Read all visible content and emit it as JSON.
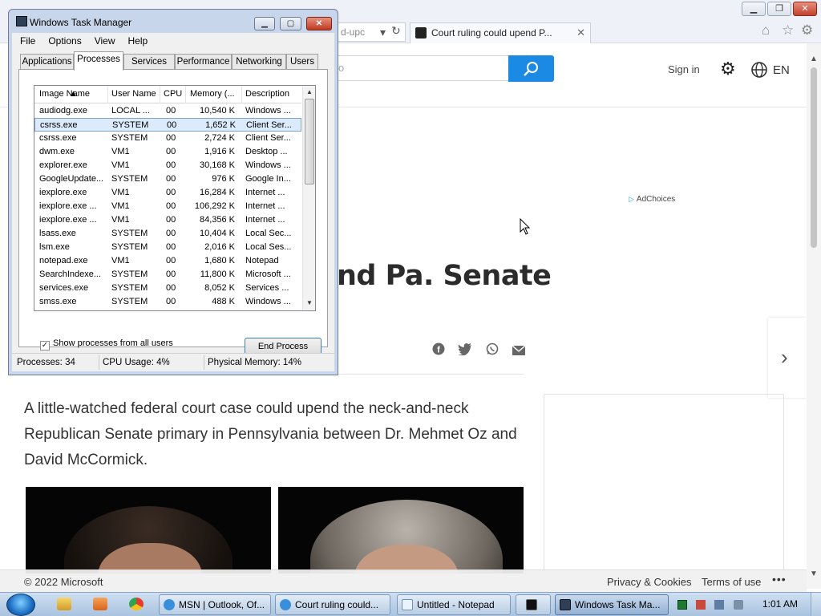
{
  "browser": {
    "address_fragment": "d-upc",
    "tabs": [
      {
        "label": "Court ruling could upend P...",
        "close": "✕"
      }
    ]
  },
  "page": {
    "search_placeholder": "o",
    "sign_in": "Sign in",
    "language": "EN",
    "adchoices": "AdChoices",
    "headline_visible": "nd Pa. Senate",
    "article_lead": "A little-watched federal court case could upend the neck-and-neck Republican Senate primary in Pennsylvania between Dr. Mehmet Oz and David McCormick.",
    "footer": {
      "copyright": "© 2022 Microsoft",
      "privacy": "Privacy & Cookies",
      "terms": "Terms of use",
      "more": "•••"
    }
  },
  "task_manager": {
    "title": "Windows Task Manager",
    "menu": [
      "File",
      "Options",
      "View",
      "Help"
    ],
    "tabs": [
      "Applications",
      "Processes",
      "Services",
      "Performance",
      "Networking",
      "Users"
    ],
    "active_tab": "Processes",
    "columns": [
      "Image Name",
      "User Name",
      "CPU",
      "Memory (...",
      "Description"
    ],
    "processes": [
      {
        "name": "audiodg.exe",
        "user": "LOCAL ...",
        "cpu": "00",
        "memory": "10,540 K",
        "desc": "Windows ..."
      },
      {
        "name": "csrss.exe",
        "user": "SYSTEM",
        "cpu": "00",
        "memory": "1,652 K",
        "desc": "Client Ser..."
      },
      {
        "name": "csrss.exe",
        "user": "SYSTEM",
        "cpu": "00",
        "memory": "2,724 K",
        "desc": "Client Ser..."
      },
      {
        "name": "dwm.exe",
        "user": "VM1",
        "cpu": "00",
        "memory": "1,916 K",
        "desc": "Desktop ..."
      },
      {
        "name": "explorer.exe",
        "user": "VM1",
        "cpu": "00",
        "memory": "30,168 K",
        "desc": "Windows ..."
      },
      {
        "name": "GoogleUpdate...",
        "user": "SYSTEM",
        "cpu": "00",
        "memory": "976 K",
        "desc": "Google In..."
      },
      {
        "name": "iexplore.exe",
        "user": "VM1",
        "cpu": "00",
        "memory": "16,284 K",
        "desc": "Internet ..."
      },
      {
        "name": "iexplore.exe ...",
        "user": "VM1",
        "cpu": "00",
        "memory": "106,292 K",
        "desc": "Internet ..."
      },
      {
        "name": "iexplore.exe ...",
        "user": "VM1",
        "cpu": "00",
        "memory": "84,356 K",
        "desc": "Internet ..."
      },
      {
        "name": "lsass.exe",
        "user": "SYSTEM",
        "cpu": "00",
        "memory": "10,404 K",
        "desc": "Local Sec..."
      },
      {
        "name": "lsm.exe",
        "user": "SYSTEM",
        "cpu": "00",
        "memory": "2,016 K",
        "desc": "Local Ses..."
      },
      {
        "name": "notepad.exe",
        "user": "VM1",
        "cpu": "00",
        "memory": "1,680 K",
        "desc": "Notepad"
      },
      {
        "name": "SearchIndexe...",
        "user": "SYSTEM",
        "cpu": "00",
        "memory": "11,800 K",
        "desc": "Microsoft ..."
      },
      {
        "name": "services.exe",
        "user": "SYSTEM",
        "cpu": "00",
        "memory": "8,052 K",
        "desc": "Services ..."
      },
      {
        "name": "smss.exe",
        "user": "SYSTEM",
        "cpu": "00",
        "memory": "488 K",
        "desc": "Windows ..."
      }
    ],
    "selected_row": 1,
    "show_all_label": "Show processes from all users",
    "show_all_checked": true,
    "end_process": "End Process",
    "status": {
      "processes": "Processes: 34",
      "cpu": "CPU Usage: 4%",
      "memory": "Physical Memory: 14%"
    }
  },
  "taskbar": {
    "buttons": [
      {
        "label": "MSN | Outlook, Of...",
        "icon": "ie-icon"
      },
      {
        "label": "Court ruling could...",
        "icon": "ie-icon"
      },
      {
        "label": "Untitled - Notepad",
        "icon": "notepad-icon"
      },
      {
        "label": "",
        "icon": "cmd-icon"
      },
      {
        "label": "Windows Task Ma...",
        "icon": "taskmgr-icon"
      }
    ],
    "clock": "1:01 AM"
  },
  "colors": {
    "accent_blue": "#1a8ae5",
    "taskbar": "#b9cde4",
    "selection": "#dcebfc"
  }
}
